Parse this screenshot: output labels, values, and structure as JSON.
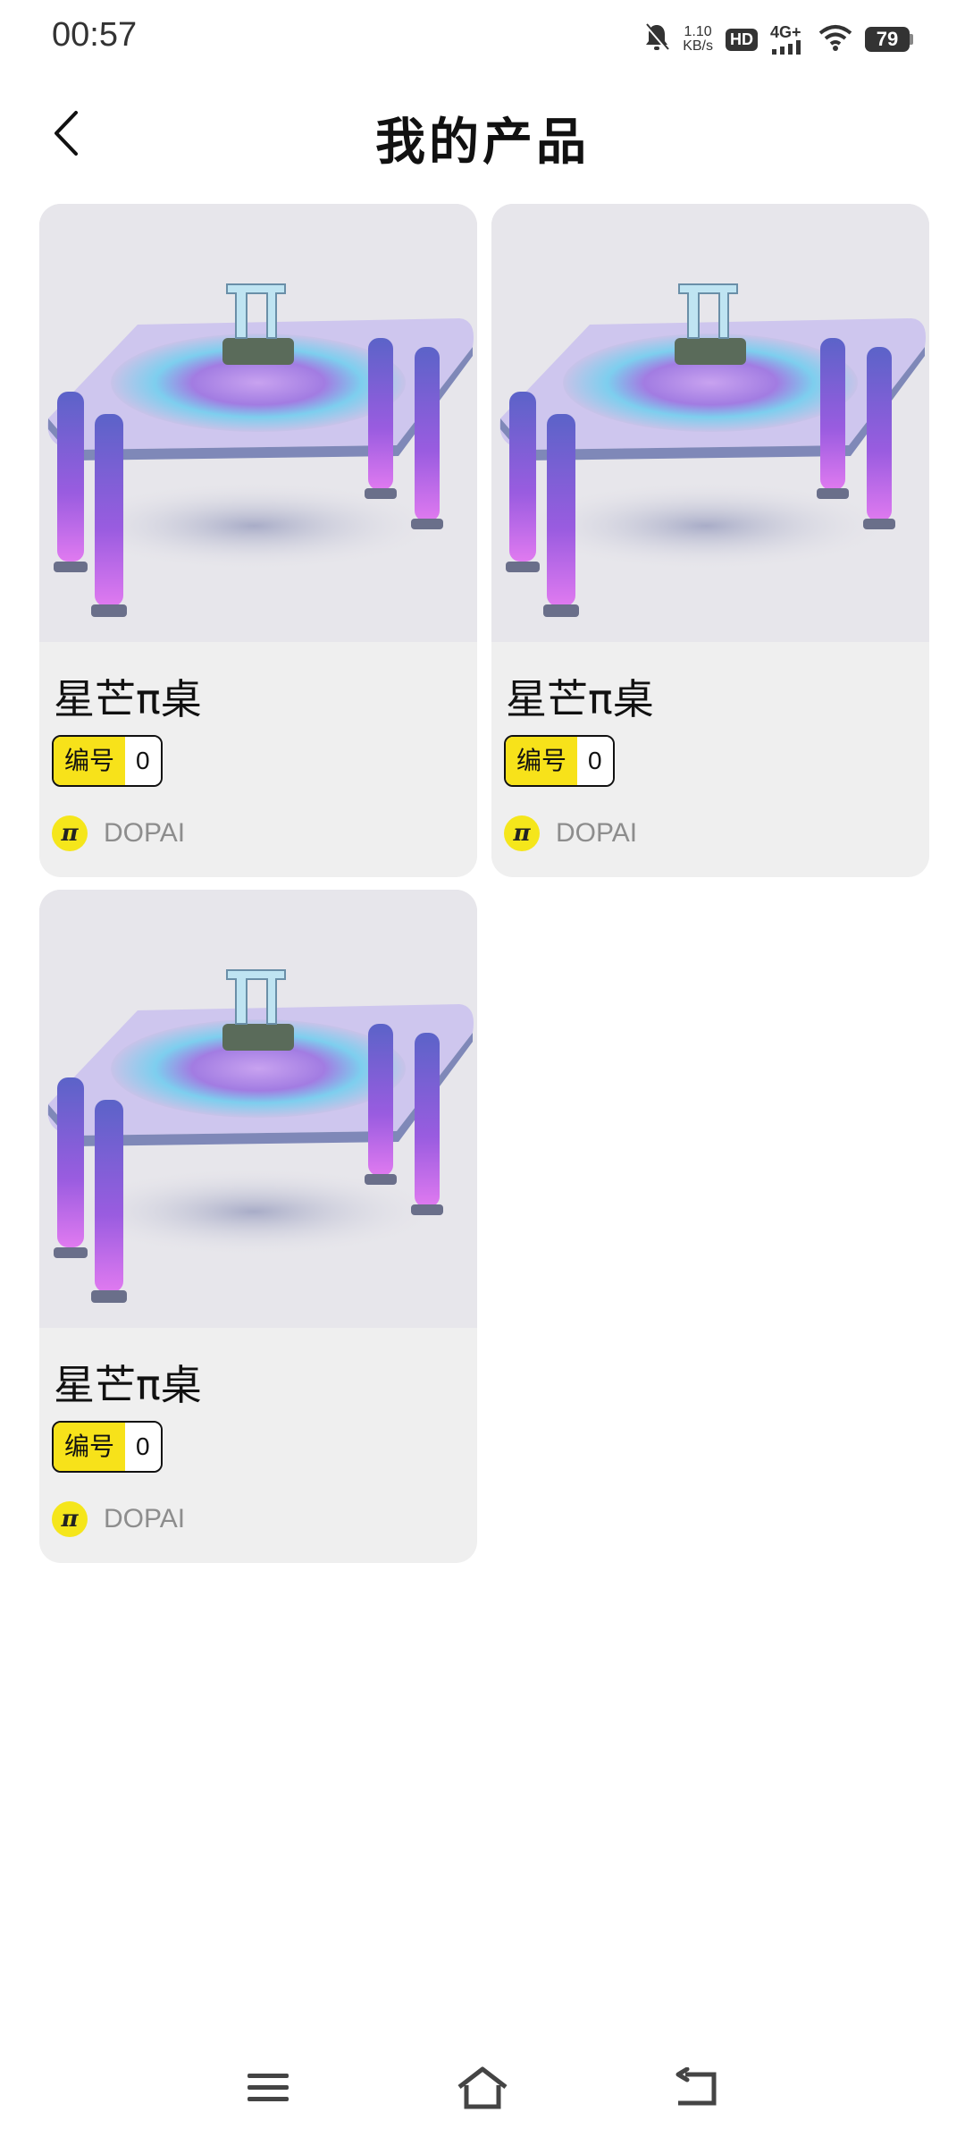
{
  "status_bar": {
    "time": "00:57",
    "net_speed_value": "1.10",
    "net_speed_unit": "KB/s",
    "hd": "HD",
    "network": "4G+",
    "battery": "79"
  },
  "header": {
    "title": "我的产品"
  },
  "products": [
    {
      "title": "星芒π桌",
      "tag_label": "编号",
      "tag_value": "0",
      "brand": "DOPAI"
    },
    {
      "title": "星芒π桌",
      "tag_label": "编号",
      "tag_value": "0",
      "brand": "DOPAI"
    },
    {
      "title": "星芒π桌",
      "tag_label": "编号",
      "tag_value": "0",
      "brand": "DOPAI"
    }
  ],
  "brand_logo_text": "π",
  "colors": {
    "tag_yellow": "#f7e21a",
    "card_bg": "#efefef",
    "brand_text": "#8d8d8d"
  },
  "icons": [
    "back-arrow-icon",
    "mute-bell-icon",
    "signal-icon",
    "wifi-icon",
    "battery-icon",
    "menu-icon",
    "home-icon",
    "return-icon"
  ]
}
